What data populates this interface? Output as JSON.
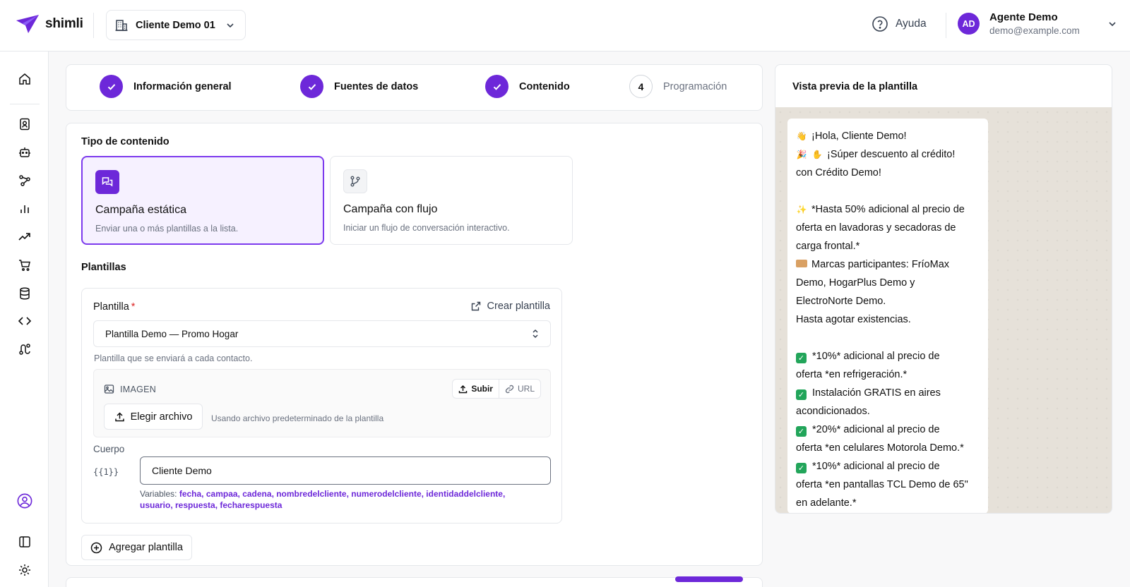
{
  "app": {
    "name": "shimli"
  },
  "topbar": {
    "client_name": "Cliente Demo 01",
    "help_label": "Ayuda",
    "user": {
      "initials": "AD",
      "name": "Agente Demo",
      "email": "demo@example.com"
    }
  },
  "stepper": {
    "steps": [
      {
        "label": "Información general",
        "state": "done"
      },
      {
        "label": "Fuentes de datos",
        "state": "done"
      },
      {
        "label": "Contenido",
        "state": "done"
      },
      {
        "label": "Programación",
        "state": "pending",
        "number": "4"
      }
    ]
  },
  "content_type": {
    "title": "Tipo de contenido",
    "options": [
      {
        "title": "Campaña estática",
        "description": "Enviar una o más plantillas a la lista.",
        "selected": true
      },
      {
        "title": "Campaña con flujo",
        "description": "Iniciar un flujo de conversación interactivo.",
        "selected": false
      }
    ]
  },
  "templates": {
    "title": "Plantillas",
    "field_label": "Plantilla",
    "required_mark": "*",
    "create_label": "Crear plantilla",
    "selected_template": "Plantilla Demo — Promo Hogar",
    "hint": "Plantilla que se enviará a cada contacto.",
    "image": {
      "label": "IMAGEN",
      "upload_label": "Subir",
      "url_label": "URL",
      "choose_file_label": "Elegir archivo",
      "file_note": "Usando archivo predeterminado de la plantilla"
    },
    "body": {
      "label": "Cuerpo",
      "token": "{{1}}",
      "value": "Cliente Demo",
      "variables_label": "Variables:",
      "variables_line1": "fecha, campaa, cadena, nombredelcliente, numerodelcliente, identidaddelcliente,",
      "variables_line2": "usuario, respuesta, fecharespuesta"
    },
    "add_label": "Agregar plantilla"
  },
  "preview": {
    "title": "Vista previa de la plantilla",
    "lines": [
      "¡Hola,  Cliente Demo!",
      "¡Súper descuento al crédito!",
      "con Crédito Demo!",
      "",
      "*Hasta 50% adicional al precio de",
      "oferta en lavadoras y secadoras de",
      "carga frontal.*",
      "Marcas participantes: FríoMax",
      "Demo, HogarPlus Demo y",
      "ElectroNorte Demo.",
      "Hasta agotar existencias.",
      "",
      "*10%* adicional al precio de",
      "oferta *en refrigeración.*",
      "Instalación GRATIS en aires",
      "acondicionados.",
      "*20%* adicional al precio de",
      "oferta *en celulares Motorola Demo.*",
      "*10%* adicional al precio de",
      "oferta *en pantallas TCL Demo de 65\"",
      "en adelante.*"
    ]
  },
  "colors": {
    "accent": "#6d28d9",
    "selected_bg": "#f6f1ff",
    "check_green": "#22a55a"
  }
}
